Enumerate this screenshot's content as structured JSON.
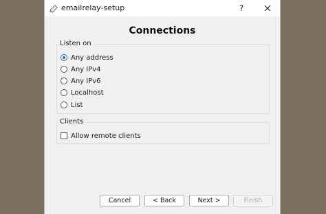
{
  "window": {
    "title": "emailrelay-setup",
    "help_label": "?",
    "page_title": "Connections"
  },
  "listen_on": {
    "group_label": "Listen on",
    "options": [
      {
        "label": "Any address",
        "selected": true
      },
      {
        "label": "Any IPv4",
        "selected": false
      },
      {
        "label": "Any IPv6",
        "selected": false
      },
      {
        "label": "Localhost",
        "selected": false
      },
      {
        "label": "List",
        "selected": false
      }
    ]
  },
  "clients": {
    "group_label": "Clients",
    "allow_remote_label": "Allow remote clients",
    "allow_remote_checked": false
  },
  "buttons": {
    "cancel": "Cancel",
    "back": "< Back",
    "next": "Next >",
    "finish": "Finish",
    "finish_enabled": false
  },
  "colors": {
    "desktop_background": "#7a6f5c",
    "dialog_background": "#f0f0f0",
    "radio_selected": "#1f6fb5"
  }
}
